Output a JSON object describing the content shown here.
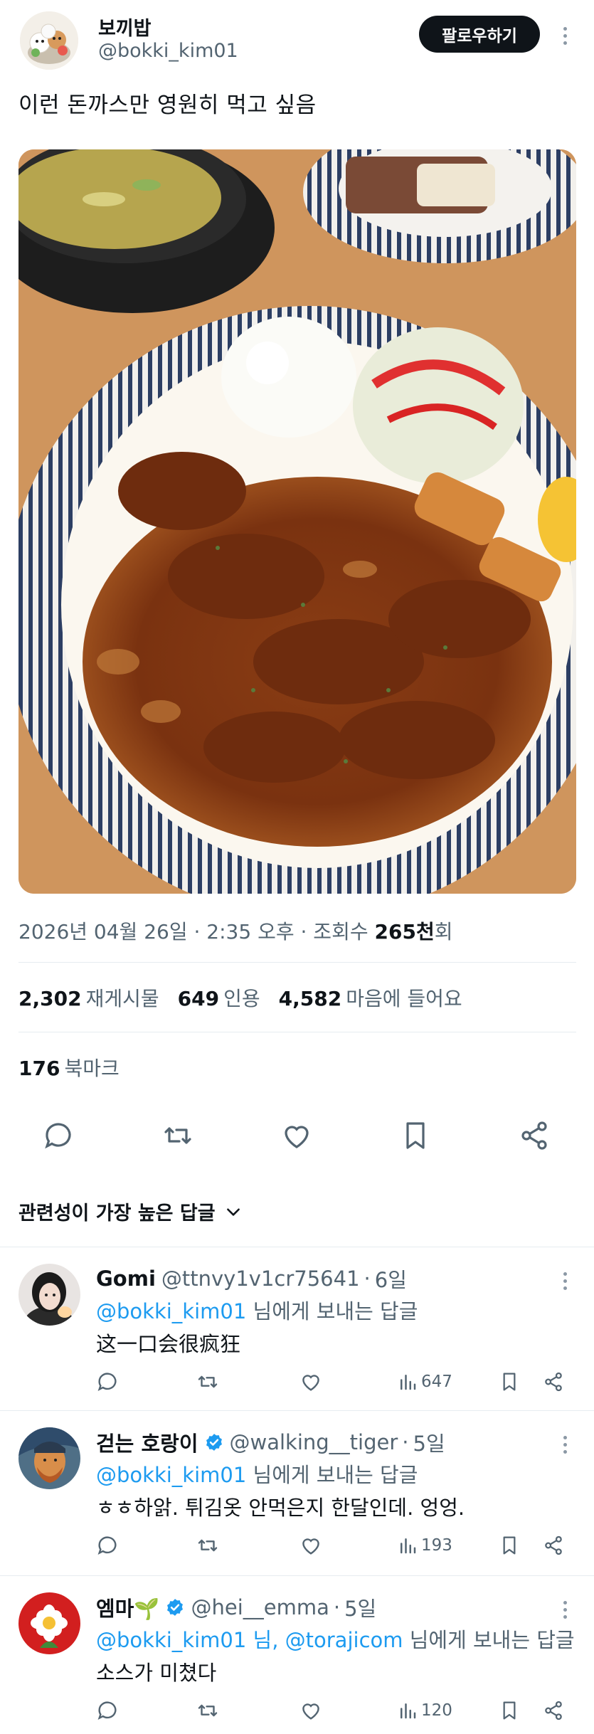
{
  "author": {
    "name": "보끼밥",
    "handle": "@bokki_kim01",
    "follow_label": "팔로우하기"
  },
  "tweet": {
    "text": "이런 돈까스만 영원히 먹고 싶음",
    "date_time": "2026년 04월 26일 · 2:35 오후",
    "views_prefix": " · 조회수 ",
    "views_value": "265천",
    "views_suffix": "회"
  },
  "stats": {
    "retweets_value": "2,302",
    "retweets_label": "재게시물",
    "quotes_value": "649",
    "quotes_label": "인용",
    "likes_value": "4,582",
    "likes_label": "마음에 들어요",
    "bookmarks_value": "176",
    "bookmarks_label": "북마크"
  },
  "actions": [
    "reply-icon",
    "retweet-icon",
    "heart-icon",
    "bookmark-icon",
    "share-icon"
  ],
  "sort": {
    "label": "관련성이 가장 높은 답글"
  },
  "replies": [
    {
      "name": "Gomi",
      "handle": "@ttnvy1v1cr75641",
      "time": "6일",
      "verified": false,
      "reply_to": "@bokki_kim01",
      "reply_to_extra": "",
      "reply_to_suffix": " 님에게 보내는 답글",
      "text": "这一口会很疯狂",
      "views": "647"
    },
    {
      "name": "걷는 호랑이",
      "handle": "@walking__tiger",
      "time": "5일",
      "verified": true,
      "reply_to": "@bokki_kim01",
      "reply_to_extra": "",
      "reply_to_suffix": " 님에게 보내는 답글",
      "text": "ㅎㅎ하앍. 튀김옷 안먹은지 한달인데. 엉엉.",
      "views": "193"
    },
    {
      "name": "엠마🌱",
      "handle": "@hei__emma",
      "time": "5일",
      "verified": true,
      "reply_to": "@bokki_kim01",
      "reply_to_extra": " 님, @torajicom",
      "reply_to_suffix": " 님에게 보내는 답글",
      "text": "소스가 미쳤다",
      "views": "120"
    }
  ],
  "colors": {
    "accent": "#1d9bf0",
    "secondary_text": "#536471",
    "verified": "#1d9bf0",
    "follow_bg": "#0f1419"
  }
}
